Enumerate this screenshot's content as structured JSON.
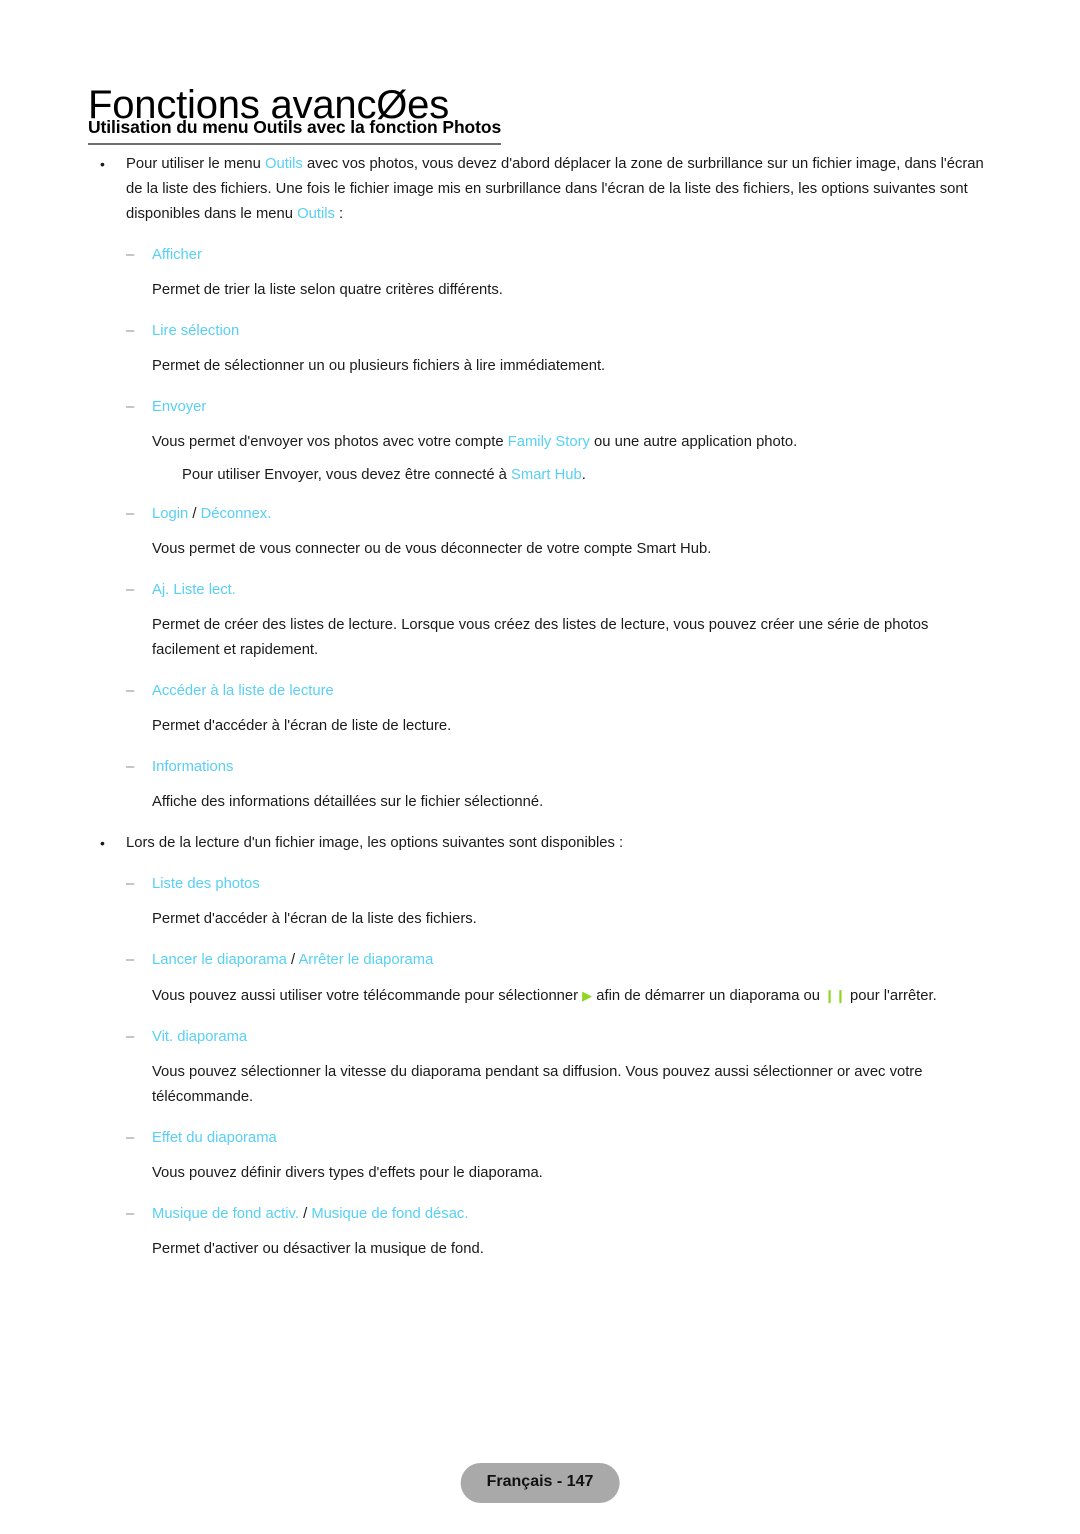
{
  "document": {
    "chapter_title": "Fonctions avancØes",
    "section_heading": "Utilisation du menu Outils avec la fonction Photos"
  },
  "intro": {
    "bullet_marker": "•",
    "part1": "Pour utiliser le menu ",
    "term1": "Outils",
    "part2": " avec vos photos, vous devez d'abord déplacer la zone de surbrillance sur un fichier image, dans l'écran de la liste des fichiers. Une fois le fichier image mis en surbrillance dans l'écran de la liste des fichiers, les options suivantes sont disponibles dans le menu ",
    "term2": "Outils",
    "part3": " :"
  },
  "tools_items": [
    {
      "marker": "–",
      "term": "Afficher",
      "description": "Permet de trier la liste selon quatre critères différents."
    },
    {
      "marker": "–",
      "term": "Lire sélection",
      "description": "Permet de sélectionner un ou plusieurs fichiers à lire immédiatement."
    },
    {
      "marker": "–",
      "term": "Envoyer",
      "desc_part1": "Vous permet d'envoyer vos photos avec votre compte ",
      "desc_term": "Family Story",
      "desc_part2": " ou une autre application photo.",
      "note_part1": "Pour utiliser Envoyer, vous devez être connecté à ",
      "note_term": "Smart Hub",
      "note_part2": "."
    },
    {
      "marker": "–",
      "term": "Login",
      "separator": " / ",
      "term2": "Déconnex.",
      "description": "Vous permet de vous connecter ou de vous déconnecter de votre compte Smart Hub."
    },
    {
      "marker": "–",
      "term": "Aj. Liste lect.",
      "description": "Permet de créer des listes de lecture. Lorsque vous créez des listes de lecture, vous pouvez créer une série de photos facilement et rapidement."
    },
    {
      "marker": "–",
      "term": "Accéder à la liste de lecture",
      "description": "Permet d'accéder à l'écran de liste de lecture."
    },
    {
      "marker": "–",
      "term": "Informations",
      "description": "Affiche des informations détaillées sur le fichier sélectionné."
    }
  ],
  "playback": {
    "bullet_marker": "•",
    "lead_in": "Lors de la lecture d'un fichier image, les options suivantes sont disponibles :",
    "items": [
      {
        "marker": "–",
        "term": "Liste des photos",
        "description": "Permet d'accéder à l'écran de la liste des fichiers."
      },
      {
        "marker": "–",
        "term": "Lancer le diaporama",
        "separator": " / ",
        "term2": "Arrêter le diaporama",
        "desc_part1": "Vous pouvez aussi utiliser votre télécommande pour sélectionner ",
        "icon_play": "▶",
        "desc_part2": " afin de démarrer un diaporama ou ",
        "icon_pause": "❙❙",
        "desc_part3": " pour l'arrêter."
      },
      {
        "marker": "–",
        "term": "Vit. diaporama",
        "desc_part1": "Vous pouvez sélectionner la vitesse du diaporama pendant sa diffusion. Vous pouvez aussi sélectionner ",
        "desc_missing_glyphs": "  ",
        "desc_part2": "or avec votre télécommande."
      },
      {
        "marker": "–",
        "term": "Effet du diaporama",
        "description": "Vous pouvez définir divers types d'effets pour le diaporama."
      },
      {
        "marker": "–",
        "term": "Musique de fond activ.",
        "separator": " / ",
        "term2": "Musique de fond désac.",
        "description": "Permet d'activer ou désactiver la musique de fond."
      }
    ]
  },
  "footer": {
    "label": "Français - 147"
  },
  "colors": {
    "accent_cyan": "#57d0f4",
    "icon_green": "#8fd61e",
    "footer_bg": "#a9a9a9",
    "heading_rule": "#6e6e6e",
    "dash_marker": "#8c8c8c",
    "body_text": "#1a1a1a"
  }
}
